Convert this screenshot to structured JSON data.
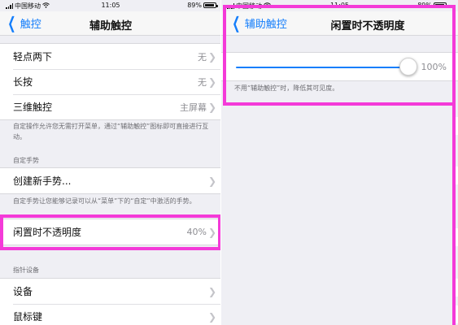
{
  "left": {
    "status": {
      "carrier": "中国移动",
      "time": "11:05",
      "battery": "89%"
    },
    "nav": {
      "back_label": "触控",
      "title": "辅助触控"
    },
    "group1": [
      {
        "label": "轻点两下",
        "value": "无"
      },
      {
        "label": "长按",
        "value": "无"
      },
      {
        "label": "三维触控",
        "value": "主屏幕"
      }
    ],
    "note1": "自定操作允许您无需打开菜单，通过“辅助触控”图标即可直接进行互动。",
    "header_custom": "自定手势",
    "create_gesture": {
      "label": "创建新手势..."
    },
    "note2": "自定手势让您能够记录可以从“菜单”下的“自定”中激活的手势。",
    "idle_opacity": {
      "label": "闲置时不透明度",
      "value": "40%"
    },
    "header_pointer": "指针设备",
    "group_pointer": [
      {
        "label": "设备"
      },
      {
        "label": "鼠标键"
      }
    ]
  },
  "right": {
    "status": {
      "carrier": "中国移动",
      "time": "11:05",
      "battery": "89%"
    },
    "nav": {
      "back_label": "辅助触控",
      "title": "闲置时不透明度"
    },
    "slider": {
      "value_label": "100%",
      "level": 1.0
    },
    "note": "不用“辅助触控”时，降低其可见度。"
  },
  "colors": {
    "accent": "#147efb",
    "highlight": "#f43ad8",
    "background": "#efeff4"
  },
  "icons": {
    "back": "chevron-left-icon",
    "disclosure": "chevron-right-icon",
    "wifi": "wifi-icon",
    "signal": "signal-bars-icon",
    "battery": "battery-icon"
  }
}
